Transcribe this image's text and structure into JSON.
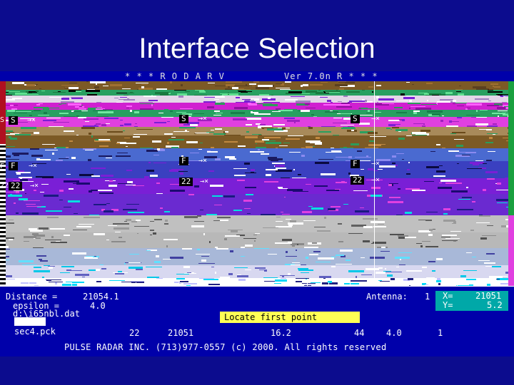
{
  "slide": {
    "title": "Interface Selection"
  },
  "app": {
    "header_left": "* * *  R O D A R   V",
    "header_right": "Ver 7.0n R * * *"
  },
  "markers": {
    "s": "S",
    "f": "F",
    "n22": "22",
    "x": "→×"
  },
  "status": {
    "distance_label": "Distance =",
    "distance_value": "21054.1",
    "epsilon_label": "epsilon =",
    "epsilon_value": "4.0",
    "file_path": "d:\\i65nbl.dat",
    "pck_file": "sec4.pck",
    "antenna_label": "Antenna:",
    "antenna_value": "1",
    "x_label": "X=",
    "x_value": "21051",
    "y_label": "Y=",
    "y_value": "5.2",
    "message": "Locate first point",
    "row": [
      "22",
      "21051",
      "16.2",
      "44",
      "4.0",
      "1"
    ],
    "footer": "PULSE RADAR INC. (713)977-0557 (c) 2000. All rights reserved"
  },
  "colors": {
    "background": "#0c0c8e",
    "panel": "#0000aa",
    "highlight": "#ffff55",
    "cyan": "#00a8a8",
    "radar_brown": "#7c5a26",
    "radar_purple": "#7a1fd6",
    "radar_magenta": "#e040e0"
  }
}
